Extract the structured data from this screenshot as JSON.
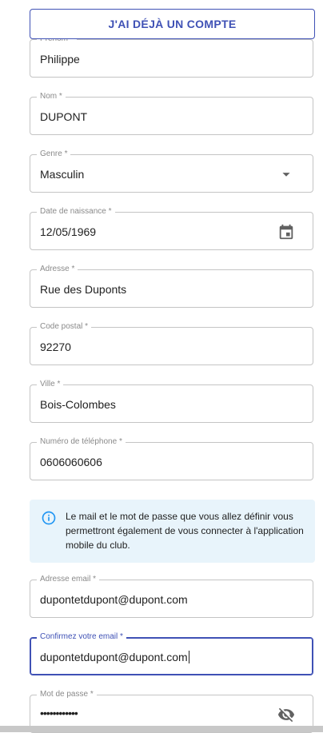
{
  "top_button": {
    "label": "J'AI DÉJÀ UN COMPTE"
  },
  "fields": {
    "prenom": {
      "label": "Prénom *",
      "value": "Philippe"
    },
    "nom": {
      "label": "Nom *",
      "value": "DUPONT"
    },
    "genre": {
      "label": "Genre *",
      "value": "Masculin",
      "icon": "dropdown-arrow-icon"
    },
    "naissance": {
      "label": "Date de naissance *",
      "value": "12/05/1969",
      "icon": "calendar-icon"
    },
    "adresse": {
      "label": "Adresse *",
      "value": "Rue des Duponts"
    },
    "code_postal": {
      "label": "Code postal *",
      "value": "92270"
    },
    "ville": {
      "label": "Ville *",
      "value": "Bois-Colombes"
    },
    "telephone": {
      "label": "Numéro de téléphone *",
      "value": "0606060606"
    },
    "email": {
      "label": "Adresse email *",
      "value": "dupontetdupont@dupont.com"
    },
    "confirm_email": {
      "label": "Confirmez votre email *",
      "value": "dupontetdupont@dupont.com"
    },
    "password": {
      "label": "Mot de passe *",
      "value": "••••••••••••",
      "icon": "eye-off-icon"
    }
  },
  "info": {
    "text": "Le mail et le mot de passe que vous allez définir vous permettront également de vous connecter à l'application mobile du club.",
    "icon": "info-icon"
  },
  "colors": {
    "accent": "#3f51b5",
    "info_bg": "#e8f4fb",
    "info_icon": "#2196f3",
    "border": "#c4c4c4"
  }
}
